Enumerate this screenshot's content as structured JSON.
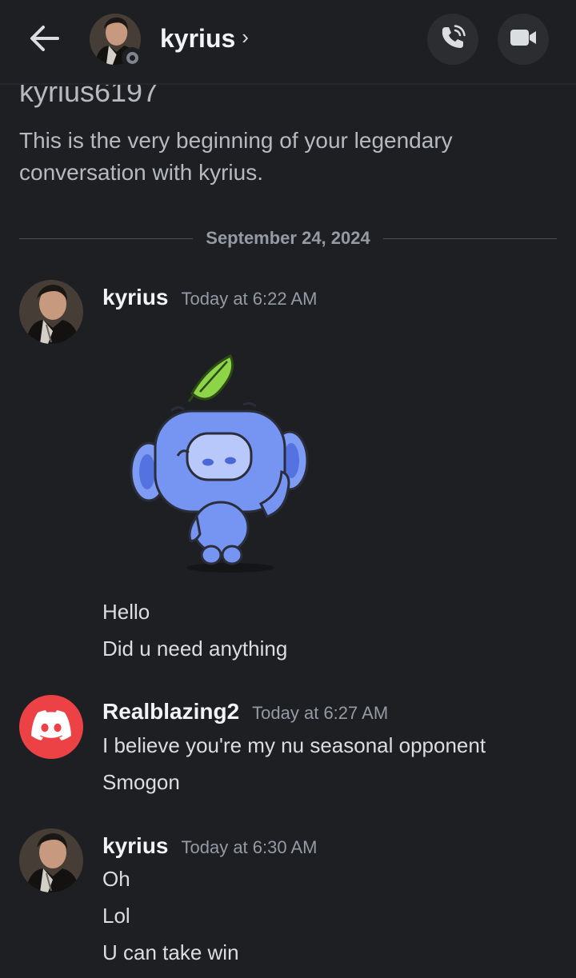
{
  "header": {
    "name": "kyrius",
    "chevron": "›",
    "back_icon": "arrow-left-icon",
    "call_icon": "phone-icon",
    "video_icon": "video-camera-icon",
    "status": "offline"
  },
  "intro": {
    "username": "kyrius6197",
    "text": "This is the very beginning of your legendary conversation with kyrius."
  },
  "divider": {
    "date": "September 24, 2024"
  },
  "messages": [
    {
      "author": "kyrius",
      "time": "Today at 6:22 AM",
      "sticker": "wumpus-waving-leaf-sticker",
      "lines": [
        "Hello",
        "Did u need anything"
      ]
    },
    {
      "author": "Realblazing2",
      "time": "Today at 6:27 AM",
      "avatar_icon": "discord-logo-icon",
      "lines": [
        "I believe you're my nu seasonal opponent",
        "Smogon"
      ]
    },
    {
      "author": "kyrius",
      "time": "Today at 6:30 AM",
      "lines": [
        "Oh",
        "Lol",
        "U can take win"
      ]
    }
  ],
  "colors": {
    "background": "#1e1f22",
    "button_bg": "#2b2d31",
    "discord_red": "#ed4245",
    "muted_text": "#949ba4",
    "wumpus_blue": "#6f8ef0",
    "leaf_green": "#8dd448"
  }
}
